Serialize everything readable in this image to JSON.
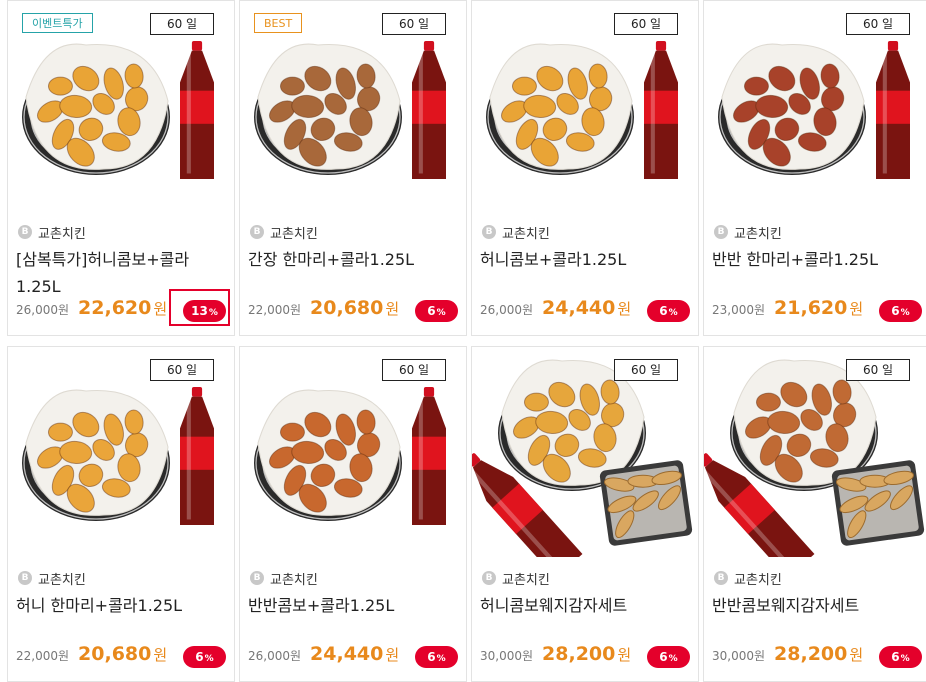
{
  "products": [
    {
      "tag": "이벤트특가",
      "tag_type": "event",
      "days": "60 일",
      "brand": "교촌치킨",
      "brand_icon": "B",
      "name": "[삼복특가]허니콤보+콜라 1.25L",
      "original_price": "26,000원",
      "sale_price": "22,620",
      "currency": "원",
      "discount": "13",
      "pct": "%",
      "chicken_color": "#e9a436",
      "layout": "basket-right-cola",
      "highlighted": true
    },
    {
      "tag": "BEST",
      "tag_type": "best",
      "days": "60 일",
      "brand": "교촌치킨",
      "brand_icon": "B",
      "name": "간장 한마리+콜라1.25L",
      "original_price": "22,000원",
      "sale_price": "20,680",
      "currency": "원",
      "discount": "6",
      "pct": "%",
      "chicken_color": "#a8683a",
      "layout": "basket-right-cola",
      "highlighted": false
    },
    {
      "tag": "",
      "tag_type": "",
      "days": "60 일",
      "brand": "교촌치킨",
      "brand_icon": "B",
      "name": "허니콤보+콜라1.25L",
      "original_price": "26,000원",
      "sale_price": "24,440",
      "currency": "원",
      "discount": "6",
      "pct": "%",
      "chicken_color": "#e9a436",
      "layout": "basket-right-cola",
      "highlighted": false
    },
    {
      "tag": "",
      "tag_type": "",
      "days": "60 일",
      "brand": "교촌치킨",
      "brand_icon": "B",
      "name": "반반 한마리+콜라1.25L",
      "original_price": "23,000원",
      "sale_price": "21,620",
      "currency": "원",
      "discount": "6",
      "pct": "%",
      "chicken_color": "#a8422a",
      "layout": "basket-right-cola",
      "highlighted": false
    },
    {
      "tag": "",
      "tag_type": "",
      "days": "60 일",
      "brand": "교촌치킨",
      "brand_icon": "B",
      "name": "허니 한마리+콜라1.25L",
      "original_price": "22,000원",
      "sale_price": "20,680",
      "currency": "원",
      "discount": "6",
      "pct": "%",
      "chicken_color": "#eaa53a",
      "layout": "basket-right-cola",
      "highlighted": false
    },
    {
      "tag": "",
      "tag_type": "",
      "days": "60 일",
      "brand": "교촌치킨",
      "brand_icon": "B",
      "name": "반반콤보+콜라1.25L",
      "original_price": "26,000원",
      "sale_price": "24,440",
      "currency": "원",
      "discount": "6",
      "pct": "%",
      "chicken_color": "#c8682e",
      "layout": "basket-right-cola",
      "highlighted": false
    },
    {
      "tag": "",
      "tag_type": "",
      "days": "60 일",
      "brand": "교촌치킨",
      "brand_icon": "B",
      "name": "허니콤보웨지감자세트",
      "original_price": "30,000원",
      "sale_price": "28,200",
      "currency": "원",
      "discount": "6",
      "pct": "%",
      "chicken_color": "#e6a63c",
      "layout": "basket-cola-potato",
      "highlighted": false
    },
    {
      "tag": "",
      "tag_type": "",
      "days": "60 일",
      "brand": "교촌치킨",
      "brand_icon": "B",
      "name": "반반콤보웨지감자세트",
      "original_price": "30,000원",
      "sale_price": "28,200",
      "currency": "원",
      "discount": "6",
      "pct": "%",
      "chicken_color": "#c06a34",
      "layout": "basket-cola-potato",
      "highlighted": false
    }
  ]
}
